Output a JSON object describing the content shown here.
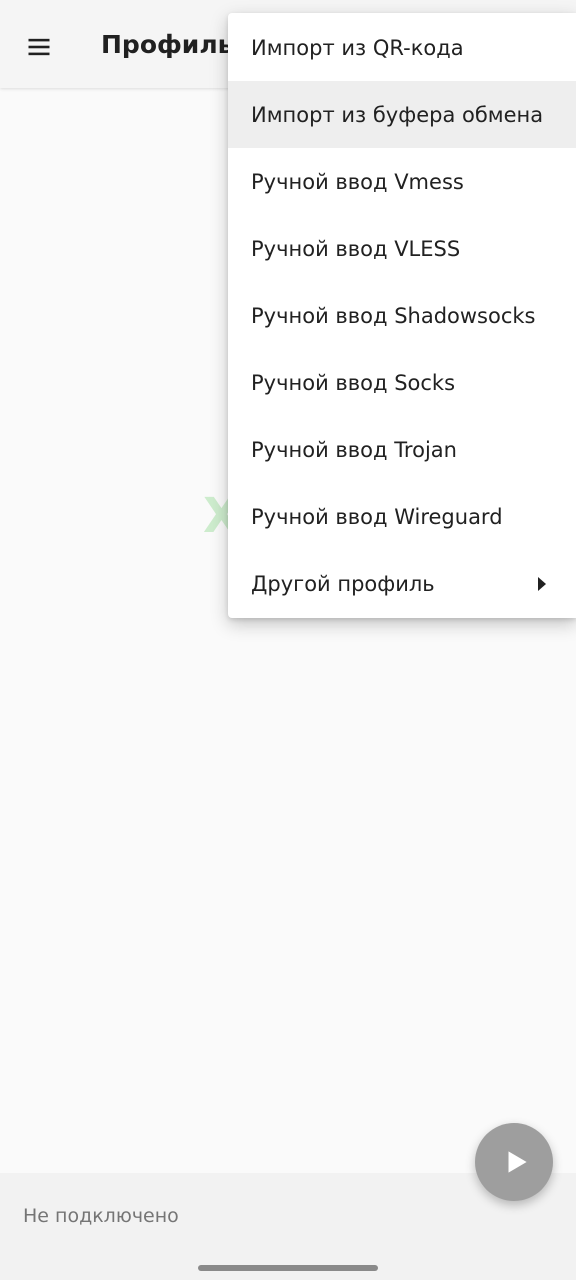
{
  "appbar": {
    "title": "Профиль",
    "menu_icon": "hamburger-menu-icon"
  },
  "dropdown": {
    "items": [
      {
        "label": "Импорт из QR-кода",
        "highlighted": false
      },
      {
        "label": "Импорт из буфера обмена",
        "highlighted": true
      },
      {
        "label": "Ручной ввод Vmess",
        "highlighted": false
      },
      {
        "label": "Ручной ввод VLESS",
        "highlighted": false
      },
      {
        "label": "Ручной ввод Shadowsocks",
        "highlighted": false
      },
      {
        "label": "Ручной ввод Socks",
        "highlighted": false
      },
      {
        "label": "Ручной ввод Trojan",
        "highlighted": false
      },
      {
        "label": "Ручной ввод Wireguard",
        "highlighted": false
      },
      {
        "label": "Другой профиль",
        "highlighted": false,
        "has_submenu": true
      }
    ]
  },
  "watermark": "XSS.is",
  "status": {
    "text": "Не подключено"
  },
  "fab": {
    "icon": "play-icon",
    "color": "#9e9e9e"
  }
}
